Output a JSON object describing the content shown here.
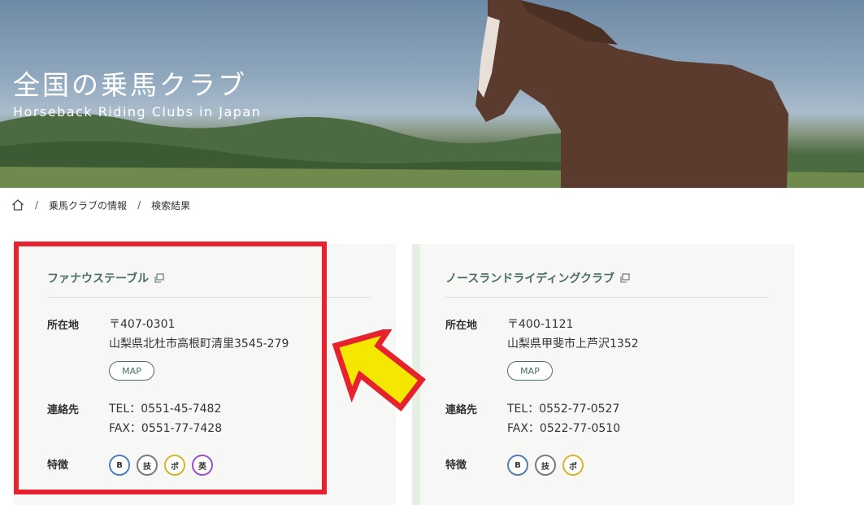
{
  "hero": {
    "title": "全国の乗馬クラブ",
    "subtitle": "Horseback Riding Clubs in Japan"
  },
  "breadcrumb": {
    "home_icon": "home-icon",
    "items": [
      "乗馬クラブの情報",
      "検索結果"
    ],
    "separator": "/"
  },
  "cards": [
    {
      "name": "ファナウステーブル",
      "address_label": "所在地",
      "postal": "〒407-0301",
      "address": "山梨県北杜市高根町清里3545-279",
      "map_label": "MAP",
      "contact_label": "連絡先",
      "tel": "TEL：0551-45-7482",
      "fax": "FAX：0551-77-7428",
      "features_label": "特徴",
      "badges": [
        {
          "text": "B",
          "color": "#4f7fb8"
        },
        {
          "text": "技",
          "color": "#7a7a7a"
        },
        {
          "text": "ポ",
          "color": "#d2b62a"
        },
        {
          "text": "英",
          "color": "#9b4fc8"
        }
      ]
    },
    {
      "name": "ノースランドライディングクラブ",
      "address_label": "所在地",
      "postal": "〒400-1121",
      "address": "山梨県甲斐市上芦沢1352",
      "map_label": "MAP",
      "contact_label": "連絡先",
      "tel": "TEL：0552-77-0527",
      "fax": "FAX：0522-77-0510",
      "features_label": "特徴",
      "badges": [
        {
          "text": "B",
          "color": "#4f7fb8"
        },
        {
          "text": "技",
          "color": "#7a7a7a"
        },
        {
          "text": "ポ",
          "color": "#d2b62a"
        }
      ]
    }
  ],
  "annotation": {
    "highlight_color": "#e5222d",
    "arrow_color": "#f5e800"
  }
}
